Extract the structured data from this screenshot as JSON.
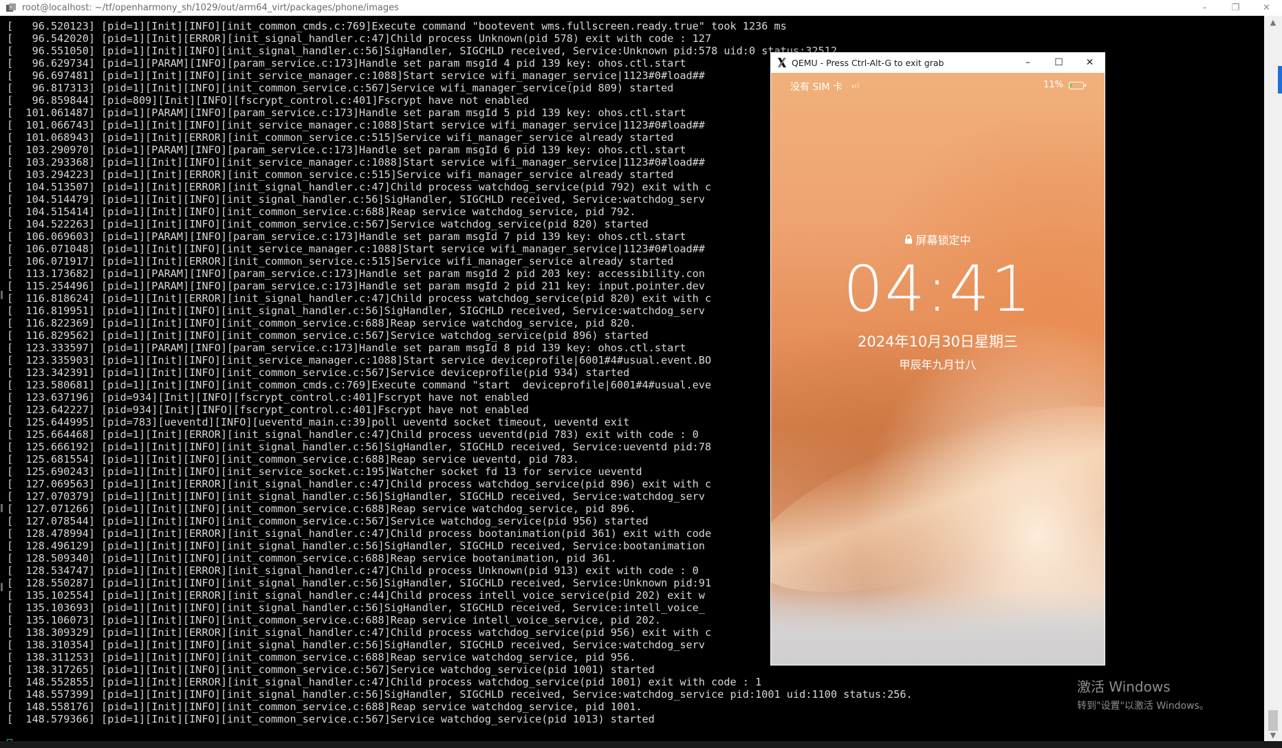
{
  "terminal": {
    "title": "root@localhost: ~/tf/openharmony_sh/1029/out/arm64_virt/packages/phone/images",
    "lines": [
      "[   96.520123] [pid=1][Init][INFO][init_common_cmds.c:769]Execute command \"bootevent wms.fullscreen.ready.true\" took 1236 ms",
      "[   96.542020] [pid=1][Init][ERROR][init_signal_handler.c:47]Child process Unknown(pid 578) exit with code : 127",
      "[   96.551050] [pid=1][Init][INFO][init_signal_handler.c:56]SigHandler, SIGCHLD received, Service:Unknown pid:578 uid:0 status:32512",
      "[   96.629734] [pid=1][PARAM][INFO][param_service.c:173]Handle set param msgId 4 pid 139 key: ohos.ctl.start",
      "[   96.697481] [pid=1][Init][INFO][init_service_manager.c:1088]Start service wifi_manager_service|1123#0#load##",
      "[   96.817313] [pid=1][Init][INFO][init_common_service.c:567]Service wifi_manager_service(pid 809) started",
      "[   96.859844] [pid=809][Init][INFO][fscrypt_control.c:401]Fscrypt have not enabled",
      "[  101.061487] [pid=1][PARAM][INFO][param_service.c:173]Handle set param msgId 5 pid 139 key: ohos.ctl.start",
      "[  101.066743] [pid=1][Init][INFO][init_service_manager.c:1088]Start service wifi_manager_service|1123#0#load##",
      "[  101.068943] [pid=1][Init][ERROR][init_common_service.c:515]Service wifi_manager_service already started",
      "[  103.290970] [pid=1][PARAM][INFO][param_service.c:173]Handle set param msgId 6 pid 139 key: ohos.ctl.start",
      "[  103.293368] [pid=1][Init][INFO][init_service_manager.c:1088]Start service wifi_manager_service|1123#0#load##",
      "[  103.294223] [pid=1][Init][ERROR][init_common_service.c:515]Service wifi_manager_service already started",
      "[  104.513507] [pid=1][Init][ERROR][init_signal_handler.c:47]Child process watchdog_service(pid 792) exit with c",
      "[  104.514479] [pid=1][Init][INFO][init_signal_handler.c:56]SigHandler, SIGCHLD received, Service:watchdog_serv",
      "[  104.515414] [pid=1][Init][INFO][init_common_service.c:688]Reap service watchdog_service, pid 792.",
      "[  104.522263] [pid=1][Init][INFO][init_common_service.c:567]Service watchdog_service(pid 820) started",
      "[  106.069603] [pid=1][PARAM][INFO][param_service.c:173]Handle set param msgId 7 pid 139 key: ohos.ctl.start",
      "[  106.071048] [pid=1][Init][INFO][init_service_manager.c:1088]Start service wifi_manager_service|1123#0#load##",
      "[  106.071917] [pid=1][Init][ERROR][init_common_service.c:515]Service wifi_manager_service already started",
      "[  113.173682] [pid=1][PARAM][INFO][param_service.c:173]Handle set param msgId 2 pid 203 key: accessibility.con",
      "[  115.254496] [pid=1][PARAM][INFO][param_service.c:173]Handle set param msgId 2 pid 211 key: input.pointer.dev",
      "[  116.818624] [pid=1][Init][ERROR][init_signal_handler.c:47]Child process watchdog_service(pid 820) exit with c",
      "[  116.819951] [pid=1][Init][INFO][init_signal_handler.c:56]SigHandler, SIGCHLD received, Service:watchdog_serv",
      "[  116.822369] [pid=1][Init][INFO][init_common_service.c:688]Reap service watchdog_service, pid 820.",
      "[  116.829562] [pid=1][Init][INFO][init_common_service.c:567]Service watchdog_service(pid 896) started",
      "[  123.333597] [pid=1][PARAM][INFO][param_service.c:173]Handle set param msgId 8 pid 139 key: ohos.ctl.start",
      "[  123.335903] [pid=1][Init][INFO][init_service_manager.c:1088]Start service deviceprofile|6001#4#usual.event.BO",
      "[  123.342391] [pid=1][Init][INFO][init_common_service.c:567]Service deviceprofile(pid 934) started",
      "[  123.580681] [pid=1][Init][INFO][init_common_cmds.c:769]Execute command \"start  deviceprofile|6001#4#usual.eve",
      "[  123.637196] [pid=934][Init][INFO][fscrypt_control.c:401]Fscrypt have not enabled",
      "[  123.642227] [pid=934][Init][INFO][fscrypt_control.c:401]Fscrypt have not enabled",
      "[  125.644995] [pid=783][ueventd][INFO][ueventd_main.c:39]poll ueventd socket timeout, ueventd exit",
      "[  125.664468] [pid=1][Init][ERROR][init_signal_handler.c:47]Child process ueventd(pid 783) exit with code : 0",
      "[  125.666192] [pid=1][Init][INFO][init_signal_handler.c:56]SigHandler, SIGCHLD received, Service:ueventd pid:78",
      "[  125.681554] [pid=1][Init][INFO][init_common_service.c:688]Reap service ueventd, pid 783.",
      "[  125.690243] [pid=1][Init][INFO][init_service_socket.c:195]Watcher socket fd 13 for service ueventd",
      "[  127.069563] [pid=1][Init][ERROR][init_signal_handler.c:47]Child process watchdog_service(pid 896) exit with c",
      "[  127.070379] [pid=1][Init][INFO][init_signal_handler.c:56]SigHandler, SIGCHLD received, Service:watchdog_serv",
      "[  127.071266] [pid=1][Init][INFO][init_common_service.c:688]Reap service watchdog_service, pid 896.",
      "[  127.078544] [pid=1][Init][INFO][init_common_service.c:567]Service watchdog_service(pid 956) started",
      "[  128.478994] [pid=1][Init][ERROR][init_signal_handler.c:47]Child process bootanimation(pid 361) exit with code",
      "[  128.496129] [pid=1][Init][INFO][init_signal_handler.c:56]SigHandler, SIGCHLD received, Service:bootanimation",
      "[  128.509340] [pid=1][Init][INFO][init_common_service.c:688]Reap service bootanimation, pid 361.",
      "[  128.534747] [pid=1][Init][ERROR][init_signal_handler.c:47]Child process Unknown(pid 913) exit with code : 0",
      "[  128.550287] [pid=1][Init][INFO][init_signal_handler.c:56]SigHandler, SIGCHLD received, Service:Unknown pid:91",
      "[  135.102554] [pid=1][Init][ERROR][init_signal_handler.c:44]Child process intell_voice_service(pid 202) exit w",
      "[  135.103693] [pid=1][Init][INFO][init_signal_handler.c:56]SigHandler, SIGCHLD received, Service:intell_voice_",
      "[  135.106073] [pid=1][Init][INFO][init_common_service.c:688]Reap service intell_voice_service, pid 202.",
      "[  138.309329] [pid=1][Init][ERROR][init_signal_handler.c:47]Child process watchdog_service(pid 956) exit with c",
      "[  138.310354] [pid=1][Init][INFO][init_signal_handler.c:56]SigHandler, SIGCHLD received, Service:watchdog_serv",
      "[  138.311253] [pid=1][Init][INFO][init_common_service.c:688]Reap service watchdog_service, pid 956.",
      "[  138.317265] [pid=1][Init][INFO][init_common_service.c:567]Service watchdog_service(pid 1001) started",
      "[  148.552855] [pid=1][Init][ERROR][init_signal_handler.c:47]Child process watchdog_service(pid 1001) exit with code : 1",
      "[  148.557399] [pid=1][Init][INFO][init_signal_handler.c:56]SigHandler, SIGCHLD received, Service:watchdog_service pid:1001 uid:1100 status:256.",
      "[  148.558176] [pid=1][Init][INFO][init_common_service.c:688]Reap service watchdog_service, pid 1001.",
      "[  148.579366] [pid=1][Init][INFO][init_common_service.c:567]Service watchdog_service(pid 1013) started"
    ],
    "window_controls": {
      "minimize": "–",
      "maximize": "❐",
      "close": "✕"
    }
  },
  "qemu": {
    "title": "QEMU - Press Ctrl-Alt-G to exit grab",
    "window_controls": {
      "minimize": "–",
      "maximize": "☐",
      "close": "✕"
    }
  },
  "lockscreen": {
    "sim_status": "没有 SIM 卡",
    "battery_percent": "11%",
    "battery_level": 0.11,
    "lock_label": "屏幕锁定中",
    "time": "04:41",
    "date": "2024年10月30日星期三",
    "lunar_date": "甲辰年九月廿八"
  },
  "watermark": {
    "title": "激活 Windows",
    "subtitle": "转到\"设置\"以激活 Windows。"
  },
  "colors": {
    "terminal_bg": "#000000",
    "terminal_text": "#d8d8d8",
    "cursor": "#22c55e",
    "battery_fill": "#3ddc5a"
  }
}
